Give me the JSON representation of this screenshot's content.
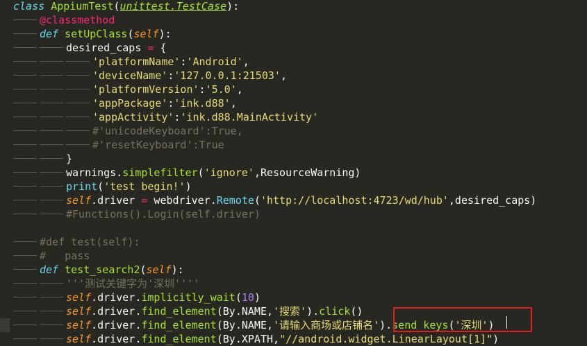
{
  "lines": [
    {
      "indent": 0,
      "tokens": [
        [
          "kw",
          "class"
        ],
        [
          "plain",
          " "
        ],
        [
          "cls",
          "AppiumTest"
        ],
        [
          "plain",
          "("
        ],
        [
          "inh",
          "unittest.TestCase"
        ],
        [
          "plain",
          "):"
        ]
      ]
    },
    {
      "indent": 1,
      "tokens": [
        [
          "dec",
          "@classmethod"
        ]
      ]
    },
    {
      "indent": 1,
      "tokens": [
        [
          "kw",
          "def"
        ],
        [
          "plain",
          " "
        ],
        [
          "fn",
          "setUpClass"
        ],
        [
          "plain",
          "("
        ],
        [
          "param",
          "self"
        ],
        [
          "plain",
          "):"
        ]
      ]
    },
    {
      "indent": 2,
      "tokens": [
        [
          "plain",
          "desired_caps "
        ],
        [
          "op",
          "="
        ],
        [
          "plain",
          " {"
        ]
      ]
    },
    {
      "indent": 3,
      "tokens": [
        [
          "str",
          "'platformName'"
        ],
        [
          "plain",
          ":"
        ],
        [
          "str",
          "'Android'"
        ],
        [
          "plain",
          ","
        ]
      ]
    },
    {
      "indent": 3,
      "tokens": [
        [
          "str",
          "'deviceName'"
        ],
        [
          "plain",
          ":"
        ],
        [
          "str",
          "'127.0.0.1:21503'"
        ],
        [
          "plain",
          ","
        ]
      ]
    },
    {
      "indent": 3,
      "tokens": [
        [
          "str",
          "'platformVersion'"
        ],
        [
          "plain",
          ":"
        ],
        [
          "str",
          "'5.0'"
        ],
        [
          "plain",
          ","
        ]
      ]
    },
    {
      "indent": 3,
      "tokens": [
        [
          "str",
          "'appPackage'"
        ],
        [
          "plain",
          ":"
        ],
        [
          "str",
          "'ink.d88'"
        ],
        [
          "plain",
          ","
        ]
      ]
    },
    {
      "indent": 3,
      "tokens": [
        [
          "str",
          "'appActivity'"
        ],
        [
          "plain",
          ":"
        ],
        [
          "str",
          "'ink.d88.MainActivity'"
        ]
      ]
    },
    {
      "indent": 3,
      "tokens": [
        [
          "cmt",
          "#'unicodeKeyboard':True,"
        ]
      ]
    },
    {
      "indent": 3,
      "tokens": [
        [
          "cmt",
          "#'resetKeyboard':True"
        ]
      ]
    },
    {
      "indent": 2,
      "tokens": [
        [
          "plain",
          "}"
        ]
      ]
    },
    {
      "indent": 2,
      "tokens": [
        [
          "plain",
          "warnings."
        ],
        [
          "fn",
          "simplefilter"
        ],
        [
          "plain",
          "("
        ],
        [
          "str",
          "'ignore'"
        ],
        [
          "plain",
          ",ResourceWarning)"
        ]
      ]
    },
    {
      "indent": 2,
      "tokens": [
        [
          "bi",
          "print"
        ],
        [
          "plain",
          "("
        ],
        [
          "str",
          "'test begin!'"
        ],
        [
          "plain",
          ")"
        ]
      ]
    },
    {
      "indent": 2,
      "tokens": [
        [
          "self",
          "self"
        ],
        [
          "plain",
          ".driver "
        ],
        [
          "op",
          "="
        ],
        [
          "plain",
          " webdriver."
        ],
        [
          "bi",
          "Remote"
        ],
        [
          "plain",
          "("
        ],
        [
          "str",
          "'http://localhost:4723/wd/hub'"
        ],
        [
          "plain",
          ",desired_caps)"
        ]
      ]
    },
    {
      "indent": 2,
      "tokens": [
        [
          "cmt",
          "#Functions().Login(self.driver)"
        ]
      ]
    },
    {
      "indent": 0,
      "tokens": []
    },
    {
      "indent": 1,
      "tokens": [
        [
          "cmt",
          "#def test(self):"
        ]
      ]
    },
    {
      "indent": 1,
      "tokens": [
        [
          "cmt",
          "#   pass"
        ]
      ]
    },
    {
      "indent": 1,
      "tokens": [
        [
          "kw",
          "def"
        ],
        [
          "plain",
          " "
        ],
        [
          "fn",
          "test_search2"
        ],
        [
          "plain",
          "("
        ],
        [
          "param",
          "self"
        ],
        [
          "plain",
          "):"
        ]
      ]
    },
    {
      "indent": 2,
      "tokens": [
        [
          "cmt",
          "'''测试关键字为'深圳''''"
        ]
      ]
    },
    {
      "indent": 2,
      "tokens": [
        [
          "self",
          "self"
        ],
        [
          "plain",
          ".driver."
        ],
        [
          "fn",
          "implicitly_wait"
        ],
        [
          "plain",
          "("
        ],
        [
          "num",
          "10"
        ],
        [
          "plain",
          ")"
        ]
      ]
    },
    {
      "indent": 2,
      "tokens": [
        [
          "self",
          "self"
        ],
        [
          "plain",
          ".driver."
        ],
        [
          "fn",
          "find_element"
        ],
        [
          "plain",
          "(By.NAME,"
        ],
        [
          "str",
          "'搜索'"
        ],
        [
          "plain",
          ")."
        ],
        [
          "fn",
          "click"
        ],
        [
          "plain",
          "()"
        ]
      ]
    },
    {
      "indent": 2,
      "active": true,
      "tokens": [
        [
          "self",
          "self"
        ],
        [
          "plain",
          ".driver."
        ],
        [
          "fn",
          "find_element"
        ],
        [
          "plain",
          "(By.NAME,"
        ],
        [
          "str",
          "'请输入商场或店铺名'"
        ],
        [
          "plain",
          ")."
        ],
        [
          "fn",
          "send_keys"
        ],
        [
          "plain",
          "("
        ],
        [
          "str",
          "'深圳'"
        ],
        [
          "plain",
          ")"
        ]
      ]
    },
    {
      "indent": 2,
      "tokens": [
        [
          "self",
          "self"
        ],
        [
          "plain",
          ".driver."
        ],
        [
          "fn",
          "find_element"
        ],
        [
          "plain",
          "(By.XPATH,"
        ],
        [
          "str",
          "\"//android.widget.LinearLayout[1]\""
        ],
        [
          "plain",
          ")"
        ]
      ]
    }
  ]
}
